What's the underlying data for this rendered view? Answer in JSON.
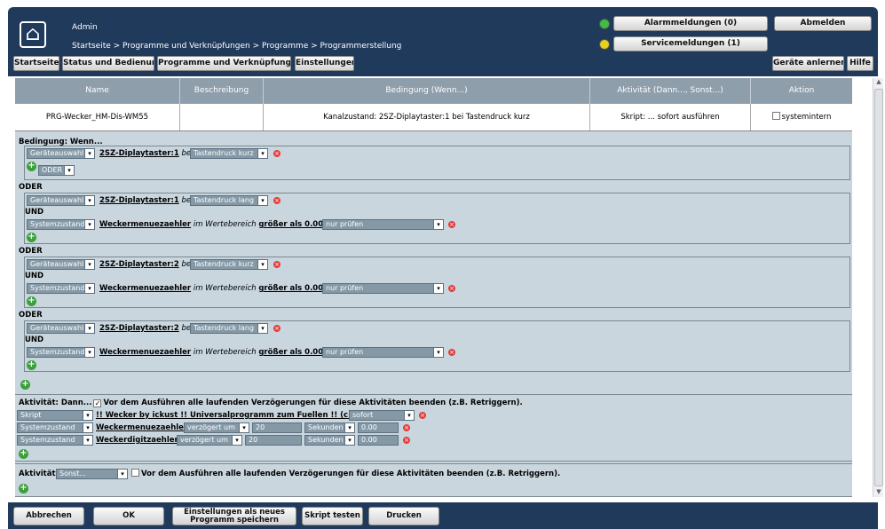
{
  "header": {
    "user": "Admin",
    "breadcrumb": "Startseite > Programme und Verknüpfungen > Programme > Programmerstellung",
    "alarm_button": "Alarmmeldungen (0)",
    "service_button": "Servicemeldungen (1)",
    "logout_button": "Abmelden",
    "nav": [
      "Startseite",
      "Status und Bedienung",
      "Programme und Verknüpfungen",
      "Einstellungen"
    ],
    "devices_button": "Geräte anlernen",
    "help_button": "Hilfe",
    "colors": {
      "alarm_led": "#3fbf3f",
      "service_led": "#e6d21c",
      "header_bg": "#1f3a5b"
    }
  },
  "table": {
    "headers": [
      "Name",
      "Beschreibung",
      "Bedingung (Wenn...)",
      "Aktivität (Dann..., Sonst...)",
      "Aktion"
    ],
    "row": {
      "name": "PRG-Wecker_HM-Dis-WM55",
      "description": "",
      "condition": "Kanalzustand: 2SZ-Diplaytaster:1 bei Tastendruck kurz",
      "activity": "Skript: ... sofort ausführen",
      "action": "systemintern"
    }
  },
  "condition_title": "Bedingung: Wenn...",
  "or_label": "ODER",
  "and_label": "UND",
  "blocks": [
    {
      "device_select": "Geräteauswahl",
      "device": "2SZ-Diplaytaster:1",
      "bei": "bei",
      "event": "Tastendruck kurz",
      "or_select": "ODER"
    },
    {
      "device_select": "Geräteauswahl",
      "device": "2SZ-Diplaytaster:1",
      "bei": "bei",
      "event": "Tastendruck lang",
      "sys_select": "Systemzustand",
      "sysvar": "Weckermenuezaehler",
      "range_text": "im Wertebereich",
      "range_value": "größer als 0.00",
      "check": "nur prüfen"
    },
    {
      "device_select": "Geräteauswahl",
      "device": "2SZ-Diplaytaster:2",
      "bei": "bei",
      "event": "Tastendruck kurz",
      "sys_select": "Systemzustand",
      "sysvar": "Weckermenuezaehler",
      "range_text": "im Wertebereich",
      "range_value": "größer als 0.00",
      "check": "nur prüfen"
    },
    {
      "device_select": "Geräteauswahl",
      "device": "2SZ-Diplaytaster:2",
      "bei": "bei",
      "event": "Tastendruck lang",
      "sys_select": "Systemzustand",
      "sysvar": "Weckermenuezaehler",
      "range_text": "im Wertebereich",
      "range_value": "größer als 0.00",
      "check": "nur prüfen"
    }
  ],
  "activity_then": {
    "title": "Aktivität: Dann...",
    "checkbox_text": "Vor dem Ausführen alle laufenden Verzögerungen für diese Aktivitäten beenden (z.B. Retriggern).",
    "rows": [
      {
        "type": "Skript",
        "target": "!! Wecker by ickust !! Universalprogramm zum Fuellen !! (c) ...",
        "timing": "sofort"
      },
      {
        "type": "Systemzustand",
        "target": "Weckermenuezaehler",
        "timing": "verzögert um",
        "value": "20",
        "unit": "Sekunden",
        "set": "0.00"
      },
      {
        "type": "Systemzustand",
        "target": "Weckerdigitzaehler",
        "timing": "verzögert um",
        "value": "20",
        "unit": "Sekunden",
        "set": "0.00"
      }
    ]
  },
  "activity_else": {
    "title": "Aktivität:",
    "select": "Sonst...",
    "checkbox_text": "Vor dem Ausführen alle laufenden Verzögerungen für diese Aktivitäten beenden (z.B. Retriggern)."
  },
  "footer": {
    "cancel": "Abbrechen",
    "ok": "OK",
    "save_as_new_1": "Einstellungen als neues",
    "save_as_new_2": "Programm speichern",
    "test_script": "Skript testen",
    "print": "Drucken"
  },
  "icons": {
    "add": "+",
    "delete": "×",
    "dropdown": "▾",
    "checkmark": "✓",
    "logo": "⌂"
  }
}
